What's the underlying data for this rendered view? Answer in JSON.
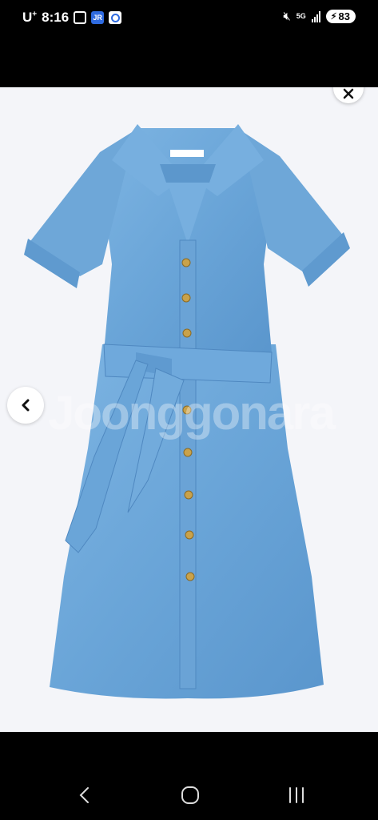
{
  "status_bar": {
    "carrier": "U",
    "carrier_sup": "+",
    "time": "8:16",
    "icons": [
      "screenshot-icon",
      "jr-app-icon",
      "location-app-icon"
    ],
    "jr_icon_text": "JR",
    "network": "5G",
    "battery": "83"
  },
  "viewer": {
    "watermark": "Joonggonara",
    "image_subject": "denim-shirt-dress",
    "colors": {
      "background": "#f4f5f9",
      "denim": "#6ea7d8",
      "denim_dark": "#4f88c0"
    }
  },
  "nav_bar": {
    "buttons": [
      "back",
      "home",
      "recents"
    ]
  }
}
